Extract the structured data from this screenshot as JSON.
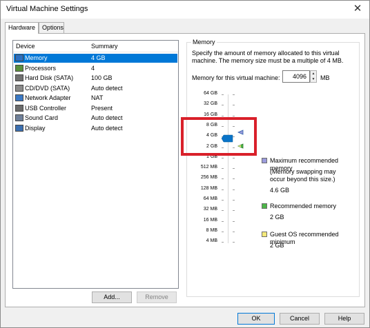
{
  "window": {
    "title": "Virtual Machine Settings",
    "close_glyph": "✕"
  },
  "tabs": [
    {
      "label": "Hardware"
    },
    {
      "label": "Options"
    }
  ],
  "device_list": {
    "columns": {
      "device": "Device",
      "summary": "Summary"
    },
    "rows": [
      {
        "device": "Memory",
        "summary": "4 GB",
        "icon": "memory-icon"
      },
      {
        "device": "Processors",
        "summary": "4",
        "icon": "processor-icon"
      },
      {
        "device": "Hard Disk (SATA)",
        "summary": "100 GB",
        "icon": "hard-disk-icon"
      },
      {
        "device": "CD/DVD (SATA)",
        "summary": "Auto detect",
        "icon": "cd-dvd-icon"
      },
      {
        "device": "Network Adapter",
        "summary": "NAT",
        "icon": "network-adapter-icon"
      },
      {
        "device": "USB Controller",
        "summary": "Present",
        "icon": "usb-icon"
      },
      {
        "device": "Sound Card",
        "summary": "Auto detect",
        "icon": "sound-card-icon"
      },
      {
        "device": "Display",
        "summary": "Auto detect",
        "icon": "display-icon"
      }
    ],
    "selected_index": 0
  },
  "buttons": {
    "add": "Add...",
    "remove": "Remove"
  },
  "memory": {
    "group_title": "Memory",
    "description": "Specify the amount of memory allocated to this virtual machine. The memory size must be a multiple of 4 MB.",
    "field_label": "Memory for this virtual machine:",
    "value": "4096",
    "unit": "MB",
    "scale_labels": [
      "64 GB",
      "32 GB",
      "16 GB",
      "8 GB",
      "4 GB",
      "2 GB",
      "1 GB",
      "512 MB",
      "256 MB",
      "128 MB",
      "64 MB",
      "32 MB",
      "16 MB",
      "8 MB",
      "4 MB"
    ],
    "current_label": "4 GB",
    "legend": {
      "max_title": "Maximum recommended memory",
      "max_note_1": "(Memory swapping may",
      "max_note_2": "occur beyond this size.)",
      "max_value": "4.6 GB",
      "rec_title": "Recommended memory",
      "rec_value": "2 GB",
      "guest_title": "Guest OS recommended minimum",
      "guest_value": "2 GB"
    },
    "colors": {
      "max": "#9b9bdc",
      "recommended": "#4cb648",
      "guest_min": "#f4e97a",
      "slider_thumb": "#0a74c8",
      "highlight": "#d9202a"
    }
  },
  "footer": {
    "ok": "OK",
    "cancel": "Cancel",
    "help": "Help"
  }
}
